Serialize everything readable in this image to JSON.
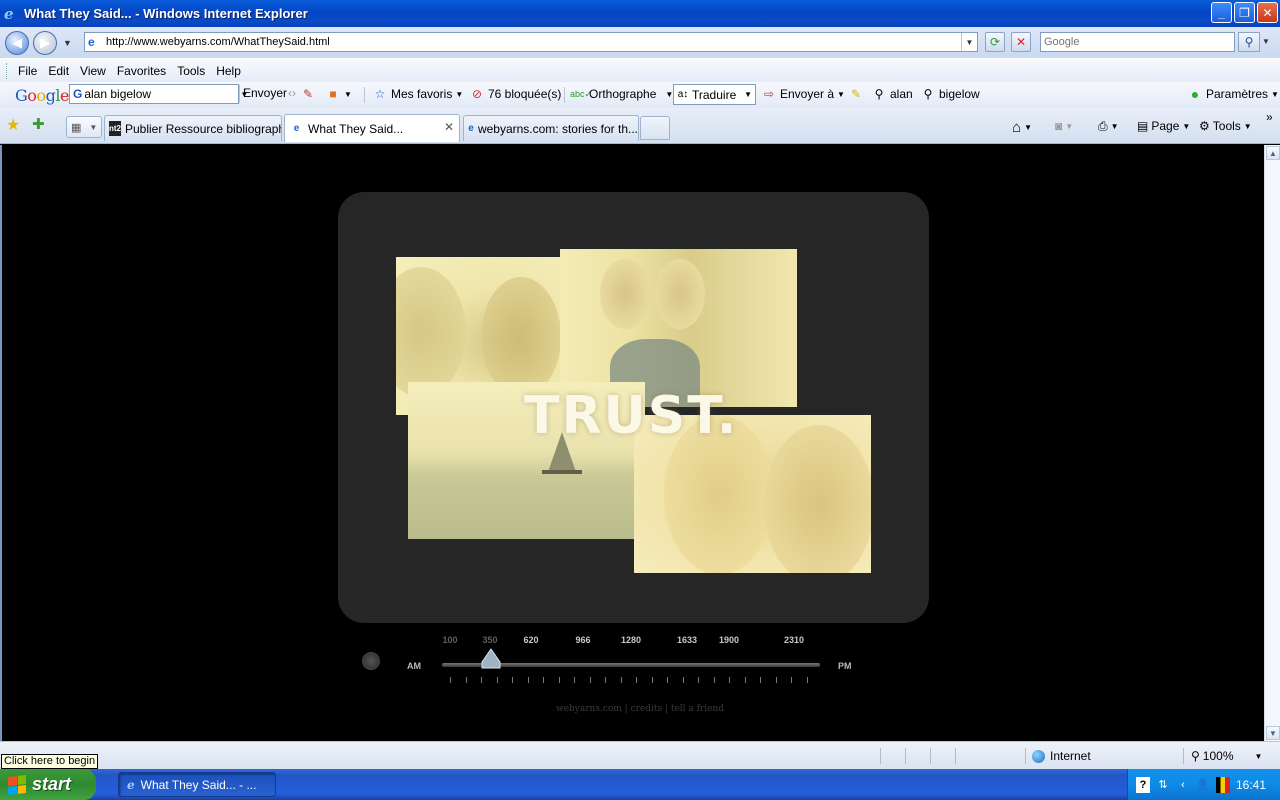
{
  "window": {
    "title": "What They Said... - Windows Internet Explorer"
  },
  "address": {
    "url": "http://www.webyarns.com/WhatTheySaid.html",
    "search_placeholder": "Google"
  },
  "menu": [
    "File",
    "Edit",
    "View",
    "Favorites",
    "Tools",
    "Help"
  ],
  "google_toolbar": {
    "logo": "Google",
    "query": "alan bigelow",
    "send": "Envoyer",
    "favorites": "Mes favoris",
    "blocked": "76 bloquée(s)",
    "spelling": "Orthographe",
    "translate": "Traduire",
    "send_to": "Envoyer à",
    "term1": "alan",
    "term2": "bigelow",
    "settings": "Paramètres"
  },
  "tabs": [
    {
      "label": "Publier Ressource bibliograph...",
      "icon": "nt2-icon",
      "active": false
    },
    {
      "label": "What They Said...",
      "icon": "ie-page-icon",
      "active": true
    },
    {
      "label": "webyarns.com: stories for th...",
      "icon": "ie-page-icon",
      "active": false
    }
  ],
  "commands": {
    "page": "Page",
    "tools": "Tools"
  },
  "content": {
    "headline": "TRUST.",
    "tuner": {
      "left_label": "AM",
      "right_label": "PM",
      "frequencies": [
        "100",
        "350",
        "620",
        "966",
        "1280",
        "1633",
        "1900",
        "2310"
      ],
      "dim_frequencies": [
        "100",
        "350"
      ],
      "selected": "350"
    },
    "footer": "webyarns.com | credits | tell a friend"
  },
  "status": {
    "tooltip": "Click here to begin",
    "zone": "Internet",
    "zoom": "100%"
  },
  "taskbar": {
    "start": "start",
    "window_item": "What They Said... - ...",
    "clock": "16:41"
  },
  "colors": {
    "titlebar": "#0546c4",
    "photo_tint": "#f1e8b0",
    "player_bg": "#262626",
    "start_green": "#3c9a3c"
  }
}
